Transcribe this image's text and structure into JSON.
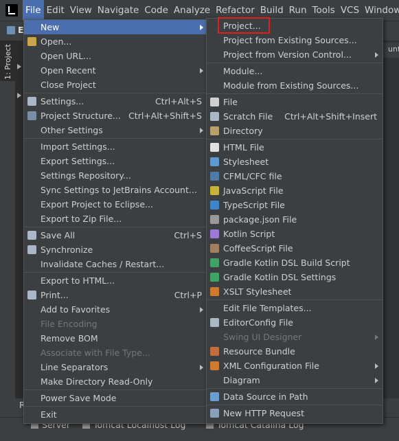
{
  "menubar": {
    "items": [
      "File",
      "Edit",
      "View",
      "Navigate",
      "Code",
      "Analyze",
      "Refactor",
      "Build",
      "Run",
      "Tools",
      "VCS",
      "Window"
    ],
    "active": "File"
  },
  "toolbar": {
    "fragment": "E"
  },
  "side_panel": {
    "label": "1: Project"
  },
  "editor": {
    "tab_fragment": "untS"
  },
  "bottom": {
    "fragment": "R",
    "tabs": [
      "Server",
      "Tomcat Localhost Log",
      "Tomcat Catalina Log"
    ]
  },
  "file_menu": {
    "items": [
      {
        "label": "New",
        "shortcut": "",
        "submenu": true,
        "highlighted": true,
        "icon": ""
      },
      {
        "label": "Open...",
        "shortcut": "",
        "icon": "folder-open-icon"
      },
      {
        "label": "Open URL...",
        "shortcut": ""
      },
      {
        "label": "Open Recent",
        "shortcut": "",
        "submenu": true
      },
      {
        "label": "Close Project",
        "shortcut": ""
      },
      {
        "separator": true
      },
      {
        "label": "Settings...",
        "shortcut": "Ctrl+Alt+S",
        "icon": "wrench-icon"
      },
      {
        "label": "Project Structure...",
        "shortcut": "Ctrl+Alt+Shift+S",
        "icon": "project-structure-icon"
      },
      {
        "label": "Other Settings",
        "shortcut": "",
        "submenu": true
      },
      {
        "separator": true
      },
      {
        "label": "Import Settings...",
        "shortcut": ""
      },
      {
        "label": "Export Settings...",
        "shortcut": ""
      },
      {
        "label": "Settings Repository...",
        "shortcut": ""
      },
      {
        "label": "Sync Settings to JetBrains Account...",
        "shortcut": ""
      },
      {
        "label": "Export Project to Eclipse...",
        "shortcut": ""
      },
      {
        "label": "Export to Zip File...",
        "shortcut": ""
      },
      {
        "separator": true
      },
      {
        "label": "Save All",
        "shortcut": "Ctrl+S",
        "icon": "save-icon"
      },
      {
        "label": "Synchronize",
        "shortcut": "",
        "icon": "sync-icon"
      },
      {
        "label": "Invalidate Caches / Restart...",
        "shortcut": ""
      },
      {
        "separator": true
      },
      {
        "label": "Export to HTML...",
        "shortcut": ""
      },
      {
        "label": "Print...",
        "shortcut": "Ctrl+P",
        "icon": "print-icon"
      },
      {
        "label": "Add to Favorites",
        "shortcut": "",
        "submenu": true
      },
      {
        "label": "File Encoding",
        "shortcut": "",
        "disabled": true
      },
      {
        "label": "Remove BOM",
        "shortcut": ""
      },
      {
        "label": "Associate with File Type...",
        "shortcut": "",
        "disabled": true
      },
      {
        "label": "Line Separators",
        "shortcut": "",
        "submenu": true
      },
      {
        "label": "Make Directory Read-Only",
        "shortcut": ""
      },
      {
        "separator": true
      },
      {
        "label": "Power Save Mode",
        "shortcut": ""
      },
      {
        "separator": true
      },
      {
        "label": "Exit",
        "shortcut": ""
      }
    ]
  },
  "new_submenu": {
    "items": [
      {
        "label": "Project...",
        "shortcut": ""
      },
      {
        "label": "Project from Existing Sources...",
        "shortcut": ""
      },
      {
        "label": "Project from Version Control...",
        "shortcut": "",
        "submenu": true
      },
      {
        "separator": true
      },
      {
        "label": "Module...",
        "shortcut": ""
      },
      {
        "label": "Module from Existing Sources...",
        "shortcut": ""
      },
      {
        "separator": true
      },
      {
        "label": "File",
        "shortcut": "",
        "icon": "file-icon"
      },
      {
        "label": "Scratch File",
        "shortcut": "Ctrl+Alt+Shift+Insert",
        "icon": "scratch-file-icon"
      },
      {
        "label": "Directory",
        "shortcut": "",
        "icon": "folder-icon"
      },
      {
        "separator": true
      },
      {
        "label": "HTML File",
        "shortcut": "",
        "icon": "html-file-icon"
      },
      {
        "label": "Stylesheet",
        "shortcut": "",
        "icon": "css-file-icon"
      },
      {
        "label": "CFML/CFC file",
        "shortcut": "",
        "icon": "cfml-file-icon"
      },
      {
        "label": "JavaScript File",
        "shortcut": "",
        "icon": "js-file-icon"
      },
      {
        "label": "TypeScript File",
        "shortcut": "",
        "icon": "ts-file-icon"
      },
      {
        "label": "package.json File",
        "shortcut": "",
        "icon": "npm-icon"
      },
      {
        "label": "Kotlin Script",
        "shortcut": "",
        "icon": "kotlin-icon"
      },
      {
        "label": "CoffeeScript File",
        "shortcut": "",
        "icon": "coffeescript-icon"
      },
      {
        "label": "Gradle Kotlin DSL Build Script",
        "shortcut": "",
        "icon": "gradle-icon"
      },
      {
        "label": "Gradle Kotlin DSL Settings",
        "shortcut": "",
        "icon": "gradle-icon"
      },
      {
        "label": "XSLT Stylesheet",
        "shortcut": "",
        "icon": "xslt-icon"
      },
      {
        "separator": true
      },
      {
        "label": "Edit File Templates...",
        "shortcut": ""
      },
      {
        "label": "EditorConfig File",
        "shortcut": "",
        "icon": "gear-icon"
      },
      {
        "label": "Swing UI Designer",
        "shortcut": "",
        "submenu": true,
        "disabled": true
      },
      {
        "label": "Resource Bundle",
        "shortcut": "",
        "icon": "resource-bundle-icon"
      },
      {
        "label": "XML Configuration File",
        "shortcut": "",
        "submenu": true,
        "icon": "xml-icon"
      },
      {
        "label": "Diagram",
        "shortcut": "",
        "submenu": true
      },
      {
        "separator": true
      },
      {
        "label": "Data Source in Path",
        "shortcut": "",
        "icon": "database-icon"
      },
      {
        "separator": true
      },
      {
        "label": "New HTTP Request",
        "shortcut": "",
        "icon": "http-request-icon"
      }
    ]
  },
  "colors": {
    "highlight": "#4b6eaf",
    "menu_bg": "#3c3f41",
    "callout_border": "#e0201b"
  }
}
